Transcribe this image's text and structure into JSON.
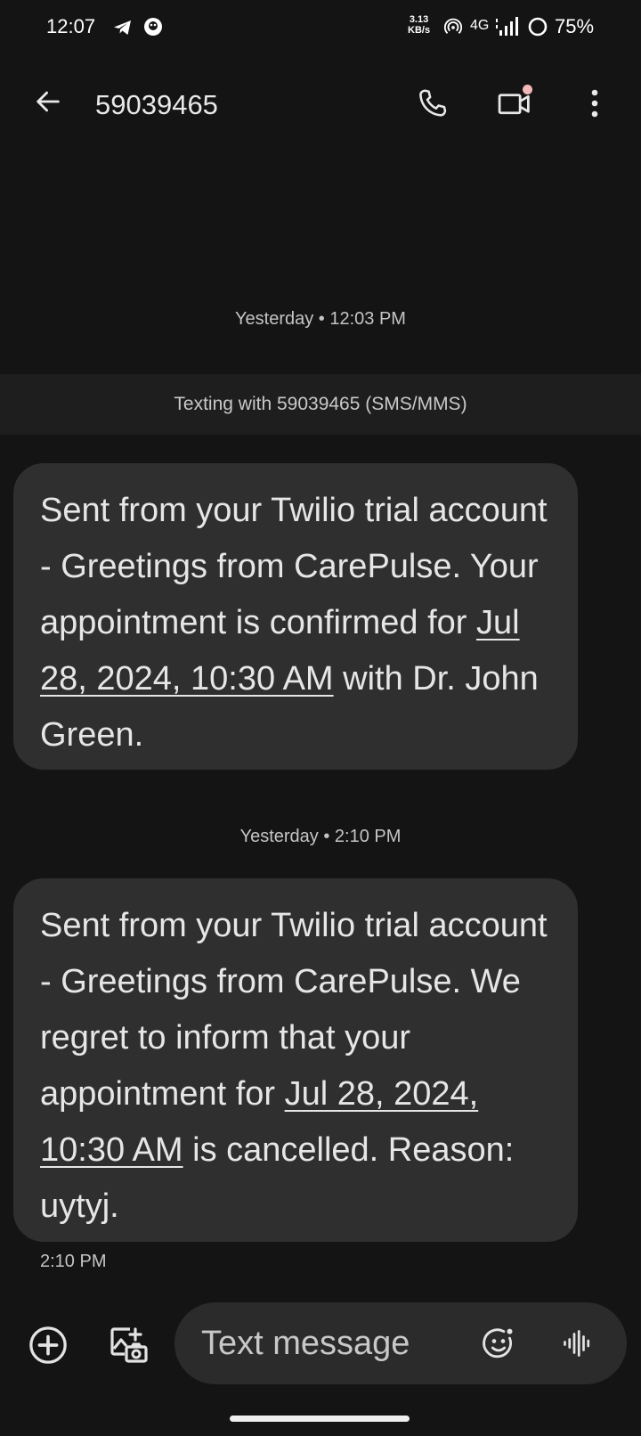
{
  "status_bar": {
    "time": "12:07",
    "speed_value": "3.13",
    "speed_unit": "KB/s",
    "network": "4G",
    "battery": "75%",
    "icons": [
      "telegram-icon",
      "app-notification-icon",
      "hotspot-icon",
      "signal-icon",
      "battery-saver-icon"
    ]
  },
  "header": {
    "title": "59039465",
    "icons": [
      "back-arrow-icon",
      "phone-icon",
      "video-camera-icon",
      "more-vert-icon"
    ]
  },
  "conversation": {
    "banner": "Texting with 59039465 (SMS/MMS)",
    "messages": [
      {
        "timestamp": "Yesterday • 12:03 PM",
        "text_before": "Sent from your Twilio trial account - Greetings from CarePulse. Your appointment is confirmed for ",
        "link": "Jul 28, 2024, 10:30 AM",
        "text_after": " with Dr. John Green."
      },
      {
        "timestamp": "Yesterday • 2:10 PM",
        "text_before": "Sent from your Twilio trial account - Greetings from CarePulse. We regret to inform that your appointment for ",
        "link": "Jul 28, 2024, 10:30 AM",
        "text_after": " is cancelled. Reason:  uytyj.",
        "time_below": "2:10 PM"
      }
    ]
  },
  "compose": {
    "placeholder": "Text message",
    "value": "",
    "icons": [
      "add-icon",
      "gallery-camera-icon",
      "emoji-icon",
      "voice-waveform-icon"
    ]
  },
  "colors": {
    "background": "#141414",
    "bubble": "#2f2f2f",
    "banner": "#1e1e1e",
    "compose": "#2b2b2b",
    "notification_dot": "#f4b8b8"
  }
}
